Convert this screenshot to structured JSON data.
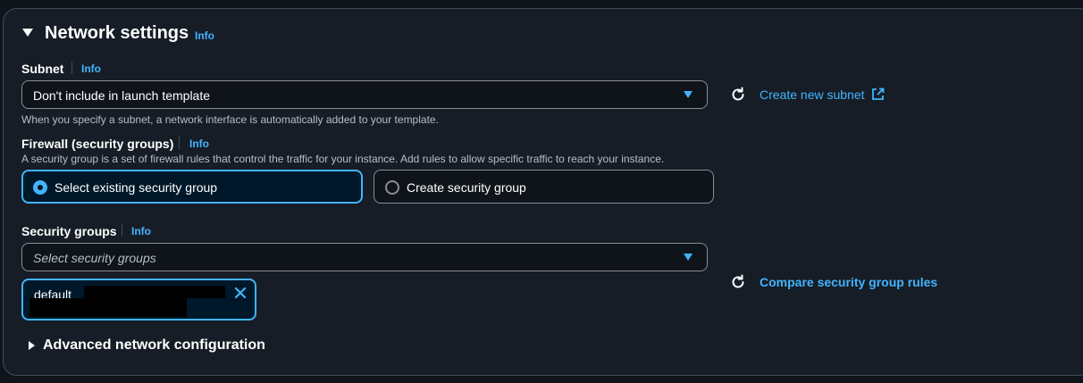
{
  "section": {
    "title": "Network settings",
    "info": "Info"
  },
  "subnet": {
    "label": "Subnet",
    "info": "Info",
    "value": "Don't include in launch template",
    "hint": "When you specify a subnet, a network interface is automatically added to your template.",
    "create_link": "Create new subnet"
  },
  "firewall": {
    "label": "Firewall (security groups)",
    "info": "Info",
    "description": "A security group is a set of firewall rules that control the traffic for your instance. Add rules to allow specific traffic to reach your instance.",
    "options": [
      {
        "label": "Select existing security group",
        "selected": true
      },
      {
        "label": "Create security group",
        "selected": false
      }
    ]
  },
  "security_groups": {
    "label": "Security groups",
    "info": "Info",
    "placeholder": "Select security groups",
    "token": "default",
    "compare_link": "Compare security group rules"
  },
  "advanced": {
    "label": "Advanced network configuration"
  },
  "colors": {
    "accent": "#42b4ff",
    "background": "#0f141a",
    "panel": "#161d26"
  }
}
